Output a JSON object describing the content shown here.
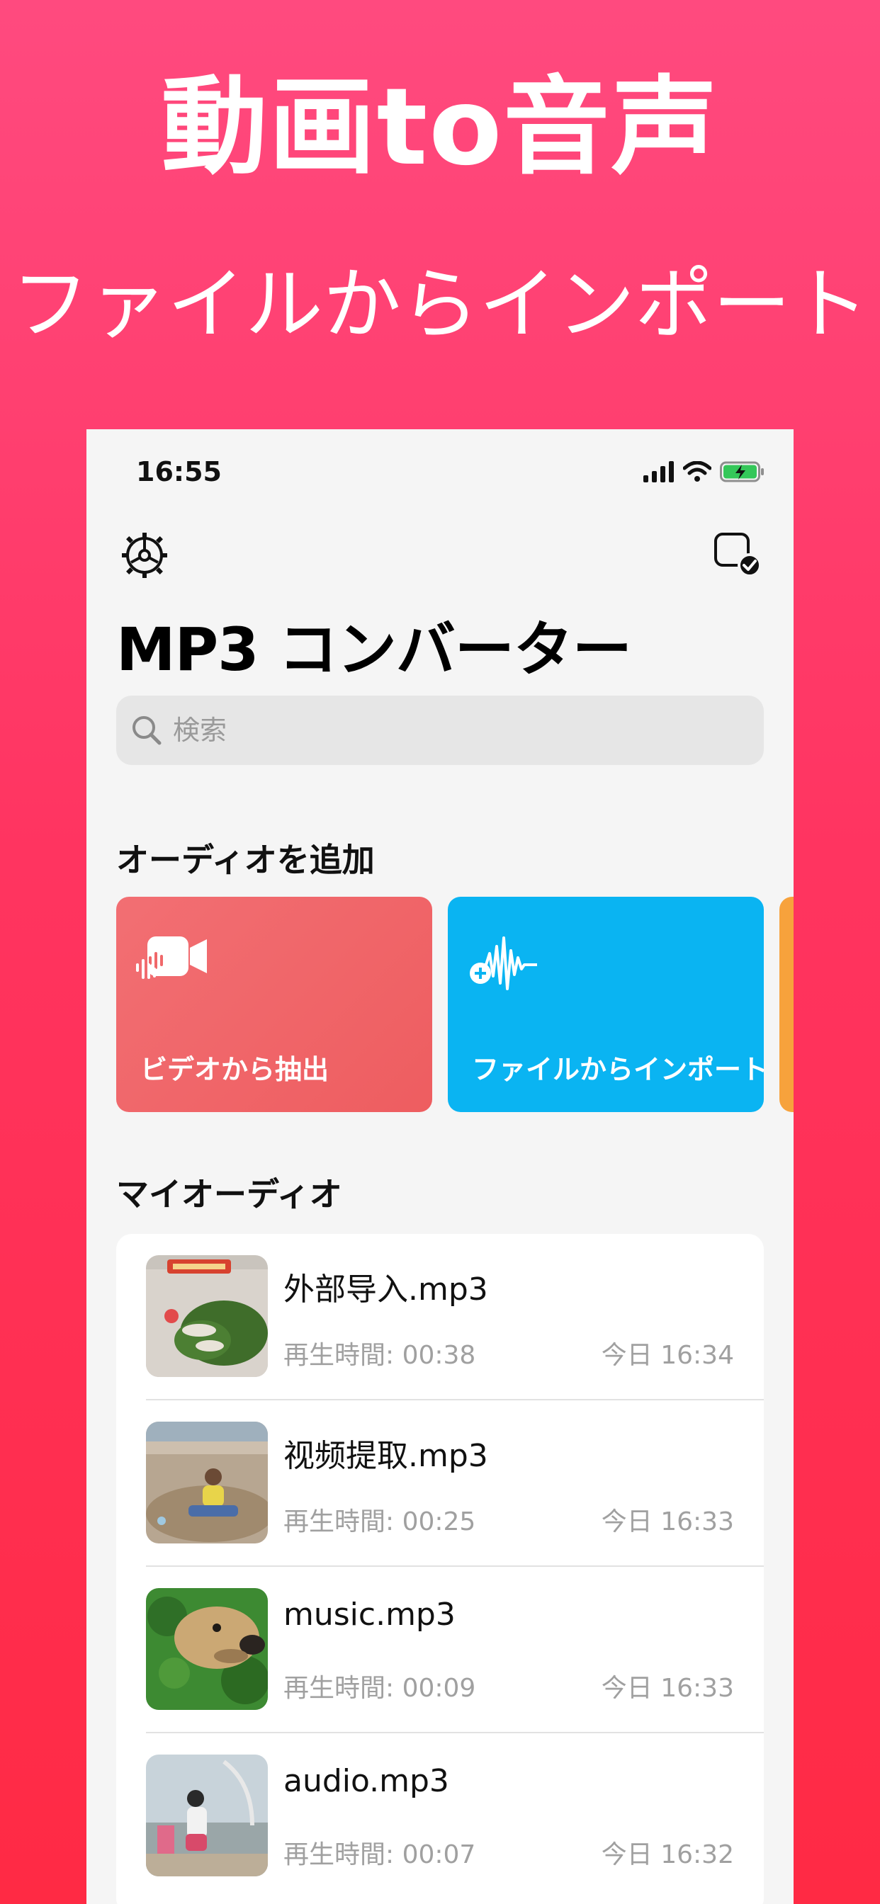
{
  "promo": {
    "title": "動画to音声",
    "subtitle": "ファイルからインポート"
  },
  "status_bar": {
    "time": "16:55",
    "icons": [
      "signal-icon",
      "wifi-icon",
      "battery-charging-icon"
    ]
  },
  "nav": {
    "settings_icon": "gear-icon",
    "select_icon": "select-check-icon"
  },
  "app": {
    "title": "MP3 コンバーター"
  },
  "search": {
    "placeholder": "検索"
  },
  "add_audio": {
    "title": "オーディオを追加",
    "cards": [
      {
        "label": "ビデオから抽出",
        "icon": "video-waveform-icon",
        "color": "#f0686a"
      },
      {
        "label": "ファイルからインポート",
        "icon": "add-waveform-icon",
        "color": "#0ab4f2"
      },
      {
        "label": "",
        "icon": "",
        "color": "#f7a23c"
      }
    ]
  },
  "my_audio": {
    "title": "マイオーディオ",
    "items": [
      {
        "title": "外部导入.mp3",
        "duration": "再生時間: 00:38",
        "date": "今日 16:34"
      },
      {
        "title": "视频提取.mp3",
        "duration": "再生時間: 00:25",
        "date": "今日 16:33"
      },
      {
        "title": "music.mp3",
        "duration": "再生時間: 00:09",
        "date": "今日 16:33"
      },
      {
        "title": "audio.mp3",
        "duration": "再生時間: 00:07",
        "date": "今日 16:32"
      }
    ]
  },
  "colors": {
    "background_top": "#ff4a7f",
    "background_bottom": "#ff2a44",
    "card_red": "#f0686a",
    "card_blue": "#0ab4f2",
    "card_orange": "#f7a23c"
  }
}
